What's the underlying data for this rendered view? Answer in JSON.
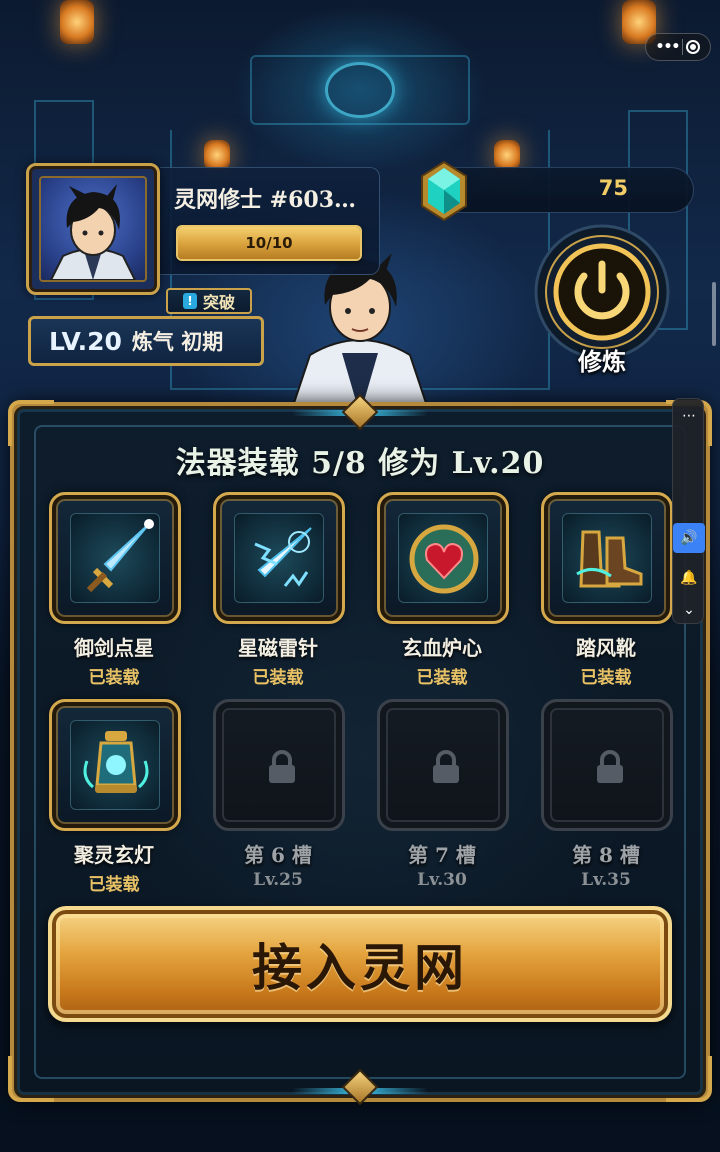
{
  "player": {
    "name": "灵网修士 #603…",
    "exp_text": "10/10",
    "exp_fraction": 1.0,
    "breakthrough_label": "突破",
    "level": "LV.20",
    "realm": "炼气 初期"
  },
  "currency": {
    "value": "75",
    "icon": "spirit-gem-icon"
  },
  "cultivate": {
    "label": "修炼",
    "icon": "power-icon"
  },
  "equipment": {
    "title": "法器装载 5/8 修为 Lv.20",
    "slots": [
      {
        "name": "御剑点星",
        "status": "已装载",
        "locked": false,
        "icon": "flying-sword-icon"
      },
      {
        "name": "星磁雷针",
        "status": "已装载",
        "locked": false,
        "icon": "thunder-needle-icon"
      },
      {
        "name": "玄血炉心",
        "status": "已装载",
        "locked": false,
        "icon": "blood-furnace-heart-icon"
      },
      {
        "name": "踏风靴",
        "status": "已装载",
        "locked": false,
        "icon": "wind-boots-icon"
      },
      {
        "name": "聚灵玄灯",
        "status": "已装载",
        "locked": false,
        "icon": "spirit-lamp-icon"
      },
      {
        "name": "第 6 槽",
        "status": "Lv.25",
        "locked": true,
        "icon": "lock-icon"
      },
      {
        "name": "第 7 槽",
        "status": "Lv.30",
        "locked": true,
        "icon": "lock-icon"
      },
      {
        "name": "第 8 槽",
        "status": "Lv.35",
        "locked": true,
        "icon": "lock-icon"
      }
    ]
  },
  "connect_button": {
    "label": "接入灵网"
  },
  "colors": {
    "gold": "#d4a94e",
    "cyan": "#3cbfe6",
    "panel_bg": "#0e1d2c"
  }
}
